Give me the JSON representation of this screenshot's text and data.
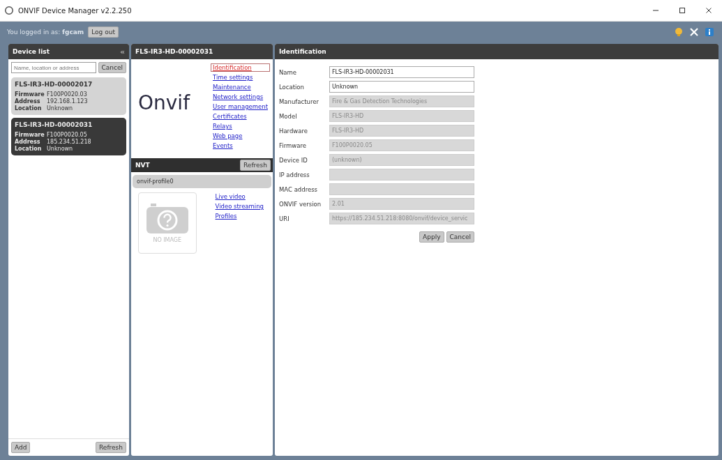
{
  "window": {
    "title": "ONVIF Device Manager v2.2.250"
  },
  "session": {
    "text": "You logged in as: **fgcam**",
    "logout": "Log out"
  },
  "device_list": {
    "title": "Device list",
    "collapse": "«",
    "search": {
      "placeholder": "Name, location or address"
    },
    "cancel": "Cancel",
    "devices": [
      {
        "name": "FLS-IR3-HD-00002017",
        "selected": false,
        "fields": [
          {
            "label": "Firmware",
            "value": "F100P0020.03"
          },
          {
            "label": "Address",
            "value": "192.168.1.123"
          },
          {
            "label": "Location",
            "value": "Unknown"
          }
        ]
      },
      {
        "name": "FLS-IR3-HD-00002031",
        "selected": true,
        "fields": [
          {
            "label": "Firmware",
            "value": "F100P0020.05"
          },
          {
            "label": "Address",
            "value": "185.234.51.218"
          },
          {
            "label": "Location",
            "value": "Unknown"
          }
        ]
      }
    ],
    "add": "Add",
    "refresh": "Refresh"
  },
  "device_panel": {
    "title": "FLS-IR3-HD-00002031",
    "logo": "Onvif",
    "links": [
      {
        "label": "Identification",
        "selected": true
      },
      {
        "label": "Time settings",
        "selected": false
      },
      {
        "label": "Maintenance",
        "selected": false
      },
      {
        "label": "Network settings",
        "selected": false
      },
      {
        "label": "User management",
        "selected": false
      },
      {
        "label": "Certificates",
        "selected": false
      },
      {
        "label": "Relays",
        "selected": false
      },
      {
        "label": "Web page",
        "selected": false
      },
      {
        "label": "Events",
        "selected": false
      }
    ],
    "nvt": {
      "title": "NVT",
      "refresh": "Refresh",
      "profile": "onvif-profile0",
      "no_image": "NO IMAGE",
      "links": [
        "Live video",
        "Video streaming",
        "Profiles"
      ]
    }
  },
  "identification": {
    "title": "Identification",
    "fields": [
      {
        "label": "Name",
        "value": "FLS-IR3-HD-00002031",
        "disabled": false
      },
      {
        "label": "Location",
        "value": "Unknown",
        "disabled": false
      },
      {
        "label": "Manufacturer",
        "value": "Fire & Gas Detection Technologies",
        "disabled": true
      },
      {
        "label": "Model",
        "value": "FLS-IR3-HD",
        "disabled": true
      },
      {
        "label": "Hardware",
        "value": "FLS-IR3-HD",
        "disabled": true
      },
      {
        "label": "Firmware",
        "value": "F100P0020.05",
        "disabled": true
      },
      {
        "label": "Device ID",
        "value": "(unknown)",
        "disabled": true
      },
      {
        "label": "IP address",
        "disabled": true
      },
      {
        "label": "MAC address",
        "disabled": true
      },
      {
        "label": "ONVIF version",
        "value": "2.01",
        "disabled": true
      },
      {
        "label": "URI",
        "value": "https://185.234.51.218:8080/onvif/device_servic",
        "disabled": true
      }
    ],
    "apply": "Apply",
    "cancel": "Cancel"
  }
}
